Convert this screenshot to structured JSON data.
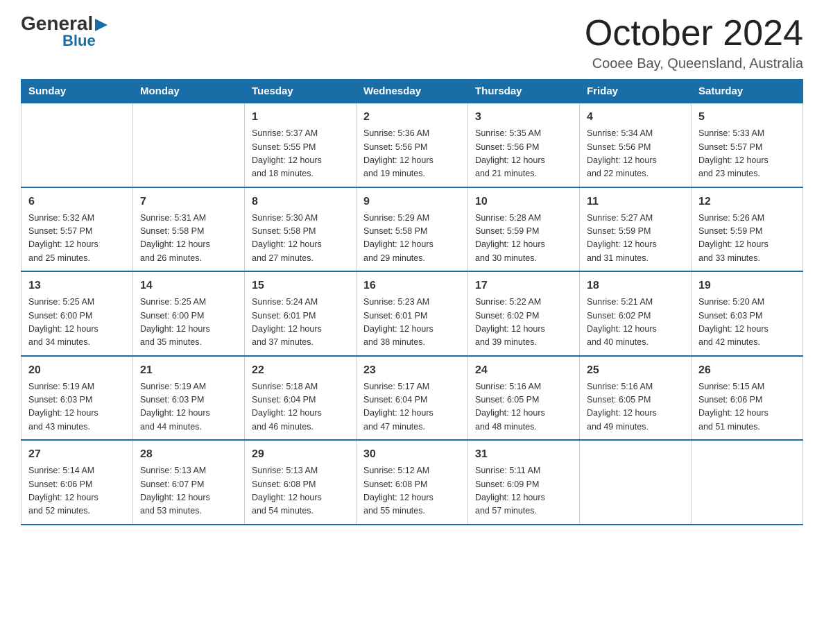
{
  "logo": {
    "general": "General",
    "blue": "Blue",
    "arrow_symbol": "▶"
  },
  "title": "October 2024",
  "subtitle": "Cooee Bay, Queensland, Australia",
  "weekdays": [
    "Sunday",
    "Monday",
    "Tuesday",
    "Wednesday",
    "Thursday",
    "Friday",
    "Saturday"
  ],
  "weeks": [
    [
      {
        "day": "",
        "info": ""
      },
      {
        "day": "",
        "info": ""
      },
      {
        "day": "1",
        "info": "Sunrise: 5:37 AM\nSunset: 5:55 PM\nDaylight: 12 hours\nand 18 minutes."
      },
      {
        "day": "2",
        "info": "Sunrise: 5:36 AM\nSunset: 5:56 PM\nDaylight: 12 hours\nand 19 minutes."
      },
      {
        "day": "3",
        "info": "Sunrise: 5:35 AM\nSunset: 5:56 PM\nDaylight: 12 hours\nand 21 minutes."
      },
      {
        "day": "4",
        "info": "Sunrise: 5:34 AM\nSunset: 5:56 PM\nDaylight: 12 hours\nand 22 minutes."
      },
      {
        "day": "5",
        "info": "Sunrise: 5:33 AM\nSunset: 5:57 PM\nDaylight: 12 hours\nand 23 minutes."
      }
    ],
    [
      {
        "day": "6",
        "info": "Sunrise: 5:32 AM\nSunset: 5:57 PM\nDaylight: 12 hours\nand 25 minutes."
      },
      {
        "day": "7",
        "info": "Sunrise: 5:31 AM\nSunset: 5:58 PM\nDaylight: 12 hours\nand 26 minutes."
      },
      {
        "day": "8",
        "info": "Sunrise: 5:30 AM\nSunset: 5:58 PM\nDaylight: 12 hours\nand 27 minutes."
      },
      {
        "day": "9",
        "info": "Sunrise: 5:29 AM\nSunset: 5:58 PM\nDaylight: 12 hours\nand 29 minutes."
      },
      {
        "day": "10",
        "info": "Sunrise: 5:28 AM\nSunset: 5:59 PM\nDaylight: 12 hours\nand 30 minutes."
      },
      {
        "day": "11",
        "info": "Sunrise: 5:27 AM\nSunset: 5:59 PM\nDaylight: 12 hours\nand 31 minutes."
      },
      {
        "day": "12",
        "info": "Sunrise: 5:26 AM\nSunset: 5:59 PM\nDaylight: 12 hours\nand 33 minutes."
      }
    ],
    [
      {
        "day": "13",
        "info": "Sunrise: 5:25 AM\nSunset: 6:00 PM\nDaylight: 12 hours\nand 34 minutes."
      },
      {
        "day": "14",
        "info": "Sunrise: 5:25 AM\nSunset: 6:00 PM\nDaylight: 12 hours\nand 35 minutes."
      },
      {
        "day": "15",
        "info": "Sunrise: 5:24 AM\nSunset: 6:01 PM\nDaylight: 12 hours\nand 37 minutes."
      },
      {
        "day": "16",
        "info": "Sunrise: 5:23 AM\nSunset: 6:01 PM\nDaylight: 12 hours\nand 38 minutes."
      },
      {
        "day": "17",
        "info": "Sunrise: 5:22 AM\nSunset: 6:02 PM\nDaylight: 12 hours\nand 39 minutes."
      },
      {
        "day": "18",
        "info": "Sunrise: 5:21 AM\nSunset: 6:02 PM\nDaylight: 12 hours\nand 40 minutes."
      },
      {
        "day": "19",
        "info": "Sunrise: 5:20 AM\nSunset: 6:03 PM\nDaylight: 12 hours\nand 42 minutes."
      }
    ],
    [
      {
        "day": "20",
        "info": "Sunrise: 5:19 AM\nSunset: 6:03 PM\nDaylight: 12 hours\nand 43 minutes."
      },
      {
        "day": "21",
        "info": "Sunrise: 5:19 AM\nSunset: 6:03 PM\nDaylight: 12 hours\nand 44 minutes."
      },
      {
        "day": "22",
        "info": "Sunrise: 5:18 AM\nSunset: 6:04 PM\nDaylight: 12 hours\nand 46 minutes."
      },
      {
        "day": "23",
        "info": "Sunrise: 5:17 AM\nSunset: 6:04 PM\nDaylight: 12 hours\nand 47 minutes."
      },
      {
        "day": "24",
        "info": "Sunrise: 5:16 AM\nSunset: 6:05 PM\nDaylight: 12 hours\nand 48 minutes."
      },
      {
        "day": "25",
        "info": "Sunrise: 5:16 AM\nSunset: 6:05 PM\nDaylight: 12 hours\nand 49 minutes."
      },
      {
        "day": "26",
        "info": "Sunrise: 5:15 AM\nSunset: 6:06 PM\nDaylight: 12 hours\nand 51 minutes."
      }
    ],
    [
      {
        "day": "27",
        "info": "Sunrise: 5:14 AM\nSunset: 6:06 PM\nDaylight: 12 hours\nand 52 minutes."
      },
      {
        "day": "28",
        "info": "Sunrise: 5:13 AM\nSunset: 6:07 PM\nDaylight: 12 hours\nand 53 minutes."
      },
      {
        "day": "29",
        "info": "Sunrise: 5:13 AM\nSunset: 6:08 PM\nDaylight: 12 hours\nand 54 minutes."
      },
      {
        "day": "30",
        "info": "Sunrise: 5:12 AM\nSunset: 6:08 PM\nDaylight: 12 hours\nand 55 minutes."
      },
      {
        "day": "31",
        "info": "Sunrise: 5:11 AM\nSunset: 6:09 PM\nDaylight: 12 hours\nand 57 minutes."
      },
      {
        "day": "",
        "info": ""
      },
      {
        "day": "",
        "info": ""
      }
    ]
  ]
}
